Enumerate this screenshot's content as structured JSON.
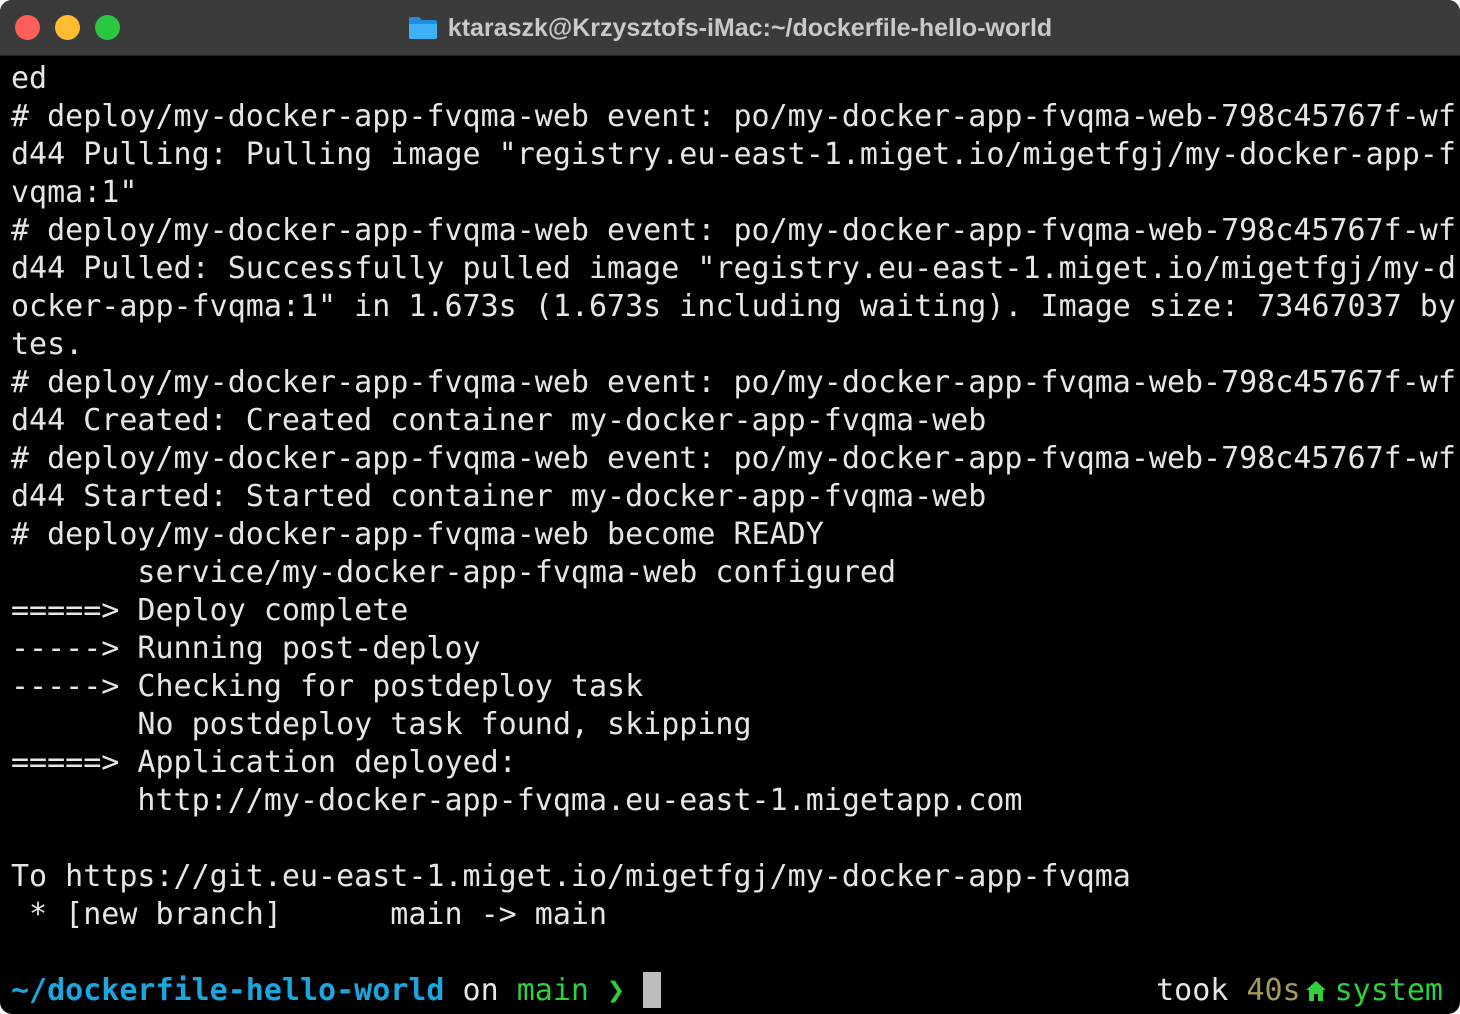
{
  "window": {
    "title": "ktaraszk@Krzysztofs-iMac:~/dockerfile-hello-world",
    "title_icon": "folder-icon",
    "controls": [
      "close",
      "minimize",
      "zoom"
    ]
  },
  "terminal": {
    "lines": [
      "ed",
      "# deploy/my-docker-app-fvqma-web event: po/my-docker-app-fvqma-web-798c45767f-wf",
      "d44 Pulling: Pulling image \"registry.eu-east-1.miget.io/migetfgj/my-docker-app-f",
      "vqma:1\"",
      "# deploy/my-docker-app-fvqma-web event: po/my-docker-app-fvqma-web-798c45767f-wf",
      "d44 Pulled: Successfully pulled image \"registry.eu-east-1.miget.io/migetfgj/my-d",
      "ocker-app-fvqma:1\" in 1.673s (1.673s including waiting). Image size: 73467037 by",
      "tes.",
      "# deploy/my-docker-app-fvqma-web event: po/my-docker-app-fvqma-web-798c45767f-wf",
      "d44 Created: Created container my-docker-app-fvqma-web",
      "# deploy/my-docker-app-fvqma-web event: po/my-docker-app-fvqma-web-798c45767f-wf",
      "d44 Started: Started container my-docker-app-fvqma-web",
      "# deploy/my-docker-app-fvqma-web become READY",
      "       service/my-docker-app-fvqma-web configured",
      "=====> Deploy complete",
      "-----> Running post-deploy",
      "-----> Checking for postdeploy task",
      "       No postdeploy task found, skipping",
      "=====> Application deployed:",
      "       http://my-docker-app-fvqma.eu-east-1.migetapp.com",
      "",
      "To https://git.eu-east-1.miget.io/migetfgj/my-docker-app-fvqma",
      " * [new branch]      main -> main",
      ""
    ]
  },
  "prompt": {
    "directory": "~/dockerfile-hello-world",
    "on": " on ",
    "branch": "main",
    "arrow": " ❯ ",
    "took_label": "took ",
    "duration": "40s",
    "env_icon": "house-icon",
    "env": "system"
  },
  "colors": {
    "background": "#000000",
    "text": "#e6e6e6",
    "directory": "#1aa7e0",
    "branch": "#2fd03b",
    "duration": "#a39a5c",
    "close": "#ff5f57",
    "minimize": "#febc2e",
    "zoom": "#28c840"
  }
}
